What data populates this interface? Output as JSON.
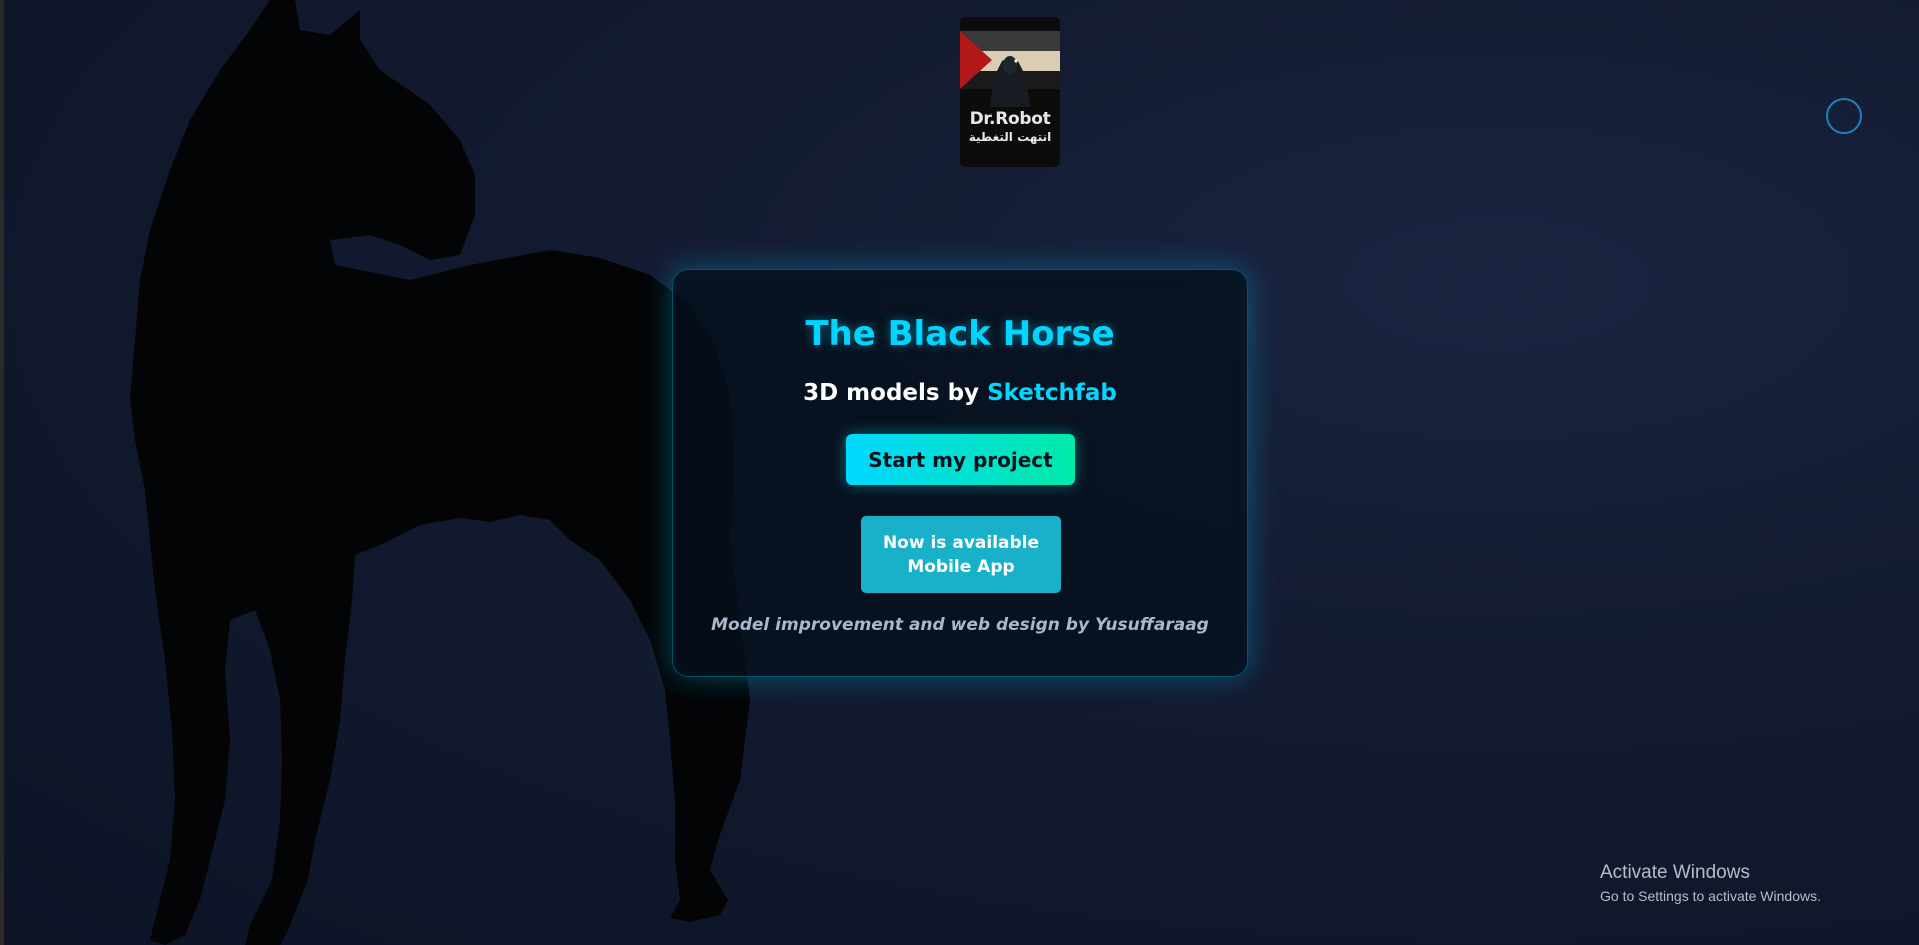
{
  "logo": {
    "name": "Dr.Robot",
    "subtitle": "انتهت التغطية"
  },
  "card": {
    "title": "The Black Horse",
    "subtitle_prefix": "3D models by ",
    "subtitle_brand": "Sketchfab",
    "start_button": "Start my project",
    "mobile_button_line1": "Now is available",
    "mobile_button_line2": "Mobile App",
    "credit": "Model improvement and web design by Yusuffaraag"
  },
  "watermark": {
    "title": "Activate Windows",
    "subtitle": "Go to Settings to activate Windows."
  },
  "colors": {
    "accent": "#00d5ff",
    "gradient_end": "#00eaa8",
    "mobile_button": "#18b1c9",
    "background": "#131a30"
  },
  "icons": {
    "corner_control": "ring-icon",
    "hero": "horse-silhouette-icon"
  }
}
